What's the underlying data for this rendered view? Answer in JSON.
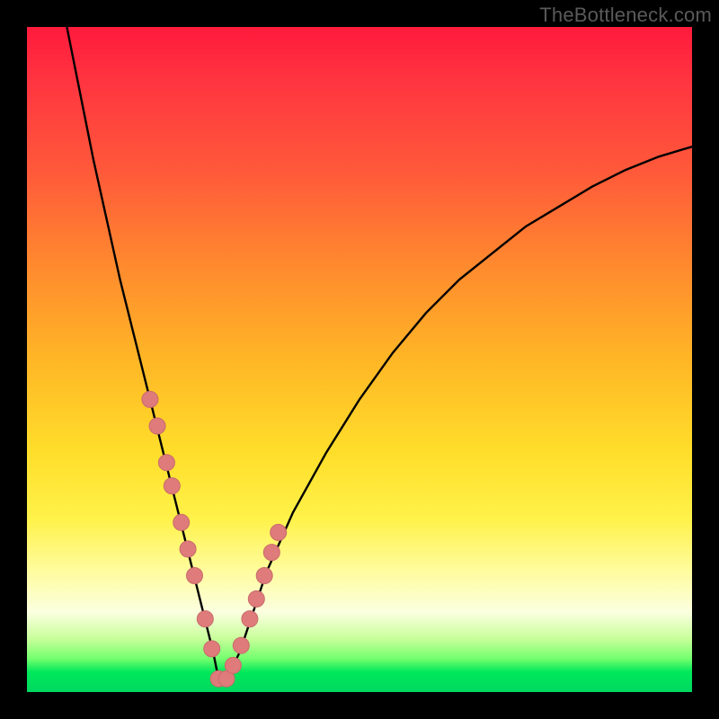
{
  "watermark": "TheBottleneck.com",
  "colors": {
    "curve": "#000000",
    "marker_fill": "#df7b7b",
    "marker_stroke": "#c96b6b",
    "frame_bg": "#000000"
  },
  "chart_data": {
    "type": "line",
    "title": "",
    "xlabel": "",
    "ylabel": "",
    "xlim": [
      0,
      100
    ],
    "ylim": [
      0,
      100
    ],
    "grid": false,
    "legend": false,
    "note": "V-shaped bottleneck curve. y ≈ deviation percentage; minimum near x≈29 where y≈0. Values below read off plotted curve in chart-percent coordinates.",
    "series": [
      {
        "name": "bottleneck_curve",
        "x": [
          6,
          8,
          10,
          12,
          14,
          16,
          18,
          20,
          22,
          24,
          26,
          28,
          29,
          30,
          32,
          34,
          36,
          40,
          45,
          50,
          55,
          60,
          65,
          70,
          75,
          80,
          85,
          90,
          95,
          100
        ],
        "y": [
          100,
          90,
          80,
          71,
          62,
          54,
          46,
          38,
          30,
          22,
          14,
          6,
          1,
          2,
          6,
          12,
          18,
          27,
          36,
          44,
          51,
          57,
          62,
          66,
          70,
          73,
          76,
          78.5,
          80.5,
          82
        ]
      }
    ],
    "markers": {
      "name": "highlighted_points",
      "x": [
        18.5,
        19.6,
        21.0,
        21.8,
        23.2,
        24.2,
        25.2,
        26.8,
        27.8,
        28.8,
        30.0,
        31.0,
        32.2,
        33.5,
        34.5,
        35.7,
        36.8,
        37.8
      ],
      "y": [
        44.0,
        40.0,
        34.5,
        31.0,
        25.5,
        21.5,
        17.5,
        11.0,
        6.5,
        2.0,
        2.0,
        4.0,
        7.0,
        11.0,
        14.0,
        17.5,
        21.0,
        24.0
      ]
    }
  }
}
